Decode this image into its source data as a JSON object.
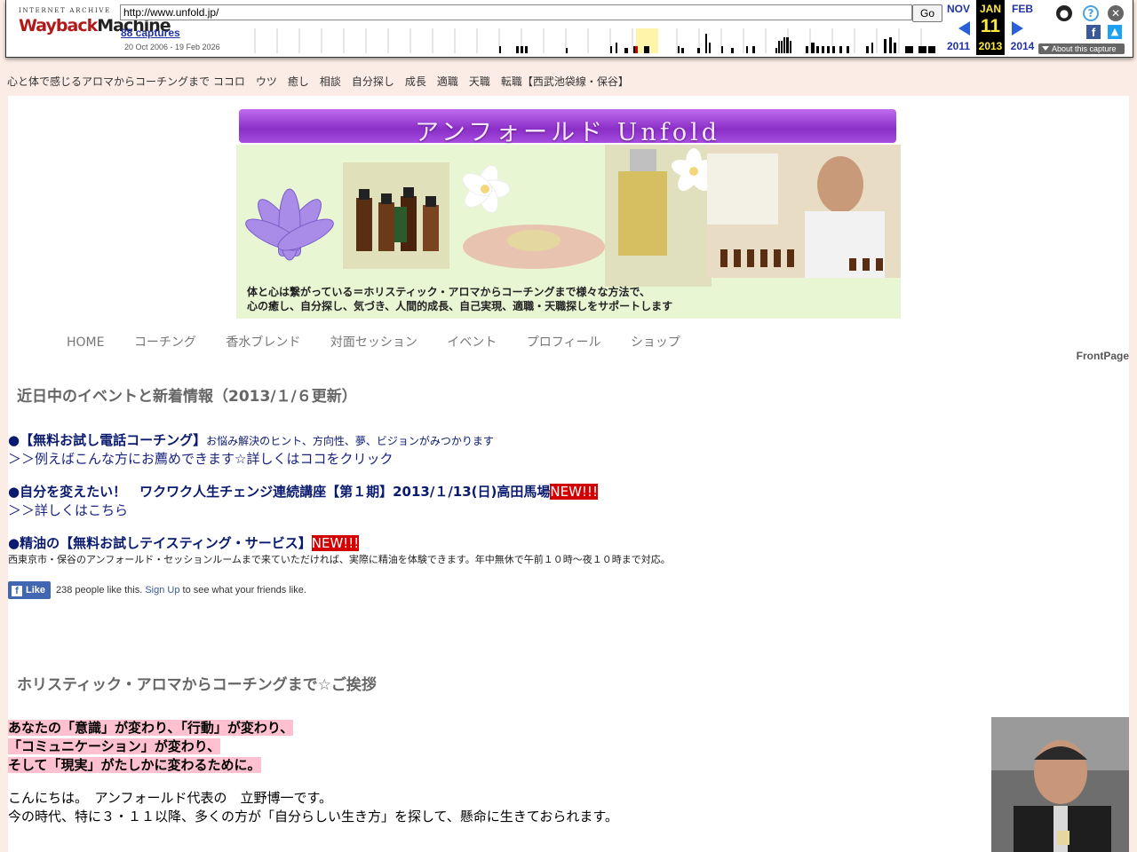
{
  "wayback": {
    "logo_top": "INTERNET ARCHIVE",
    "logo_way": "Wayback",
    "logo_machine": "Machine",
    "url": "http://www.unfold.jp/",
    "go_label": "Go",
    "captures": "88 captures",
    "range": "20 Oct 2006 - 19 Feb 2026",
    "prev_month": "NOV",
    "prev_year": "2011",
    "cur_month": "JAN",
    "cur_day": "11",
    "cur_year": "2013",
    "next_month": "FEB",
    "next_year": "2014",
    "about": "About this capture",
    "icons": [
      "user-icon",
      "help-icon",
      "close-icon",
      "facebook-icon",
      "twitter-icon"
    ]
  },
  "page": {
    "top_line": "心と体で感じるアロマからコーチングまで ココロ　ウツ　癒し　相談　自分探し　成長　適職　天職　転職【西武池袋線・保谷】",
    "banner_title": "アンフォールド Unfold",
    "banner_caption_1": "体と心は繋がっている＝ホリスティック・アロマからコーチングまで様々な方法で、",
    "banner_caption_2": "心の癒し、自分探し、気づき、人間的成長、自己実現、適職・天職探しをサポートします",
    "nav": [
      "HOME",
      "コーチング",
      "香水ブレンド",
      "対面セッション",
      "イベント",
      "プロフィール",
      "ショップ"
    ],
    "frontpage": "FrontPage",
    "news_heading": "近日中のイベントと新着情報（2013/１/６更新）",
    "item1_title": "●【無料お試し電話コーチング】",
    "item1_sub": "お悩み解決のヒント、方向性、夢、ビジョンがみつかります",
    "item1_link": "＞＞例えばこんな方にお薦めできます☆詳しくはココをクリック",
    "item2_title": "●自分を変えたい！　ワクワク人生チェンジ連続講座【第１期】2013/１/13(日)高田馬場",
    "item2_new": "NEW!!!",
    "item2_link": "＞＞詳しくはこちら",
    "item3_title": "●精油の【無料お試しテイスティング・サービス】",
    "item3_new": "NEW!!!",
    "item3_desc": "西東京市・保谷のアンフォールド・セッションルームまで来ていただければ、実際に精油を体験できます。年中無休で午前１０時〜夜１０時まで対応。",
    "fb_like": "Like",
    "fb_count_text": "238 people like this.",
    "fb_signup": "Sign Up",
    "fb_rest": "to see what your friends like.",
    "greeting_heading": "ホリスティック・アロマからコーチングまで☆ご挨拶",
    "pink1": "あなたの「意識」が変わり、「行動」が変わり、",
    "pink2": "「コミュニケーション」が変わり、",
    "pink3": "そして「現実」がたしかに変わるために。",
    "intro1": "こんにちは。　アンフォールド代表の　立野博一です。",
    "intro2": "今の時代、特に３・１１以降、多くの方が「自分らしい生き方」を探して、懸命に生きておられます。"
  },
  "colors": {
    "page_bg": "#fbece6",
    "new_badge": "#d40000",
    "highlight": "#ffc0d0",
    "navy": "#0a1a6e"
  }
}
